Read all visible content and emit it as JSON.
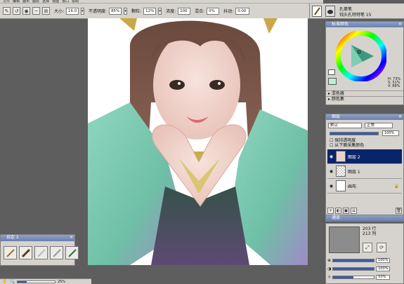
{
  "menu": [
    "文件",
    "编辑",
    "画布",
    "图层",
    "选择",
    "视图",
    "窗口",
    "帮助"
  ],
  "toolbar": {
    "size_label": "大小:",
    "size_value": "16.0",
    "opacity_label": "不透明度:",
    "opacity_value": "85%",
    "blur_label": "颗粒:",
    "blur_value": "12%",
    "density_label": "浓度:",
    "density_value": "100",
    "mix_label": "混合:",
    "mix_value": "0%",
    "jitter_label": "抖动:",
    "jitter_value": "0.00"
  },
  "brush": {
    "category": "孔豪笔",
    "variant": "钝头孔特特笔 15"
  },
  "color_panel": {
    "title": "标准颜色",
    "h_label": "H: 73%",
    "s_label": "S: 51%",
    "v_label": "V: 88%",
    "mixer_label": "混色器",
    "color_set_label": "颜色集"
  },
  "layers_panel": {
    "title": "图层",
    "composite_value": "默认",
    "blend_value": "正常",
    "opacity_value": "100%",
    "preserve_label": "保持透明度",
    "sample_label": "从下面采集颜色",
    "layers": [
      {
        "name": "图层 2",
        "selected": true
      },
      {
        "name": "图层 1",
        "selected": false
      },
      {
        "name": "画布",
        "selected": false
      }
    ]
  },
  "channels_panel": {
    "title": "通道",
    "rows_text": "203 行",
    "cols_text": "213 列",
    "percent1": "100%",
    "percent2": "100%",
    "percent3": "50%"
  },
  "custom_palette": {
    "title": "自定 1"
  },
  "status": {
    "zoom": "25%"
  },
  "colors": {
    "selected_layer": "#0a246a",
    "panel_bg": "#d6d3ce",
    "title_bar": "#6b7fae"
  }
}
